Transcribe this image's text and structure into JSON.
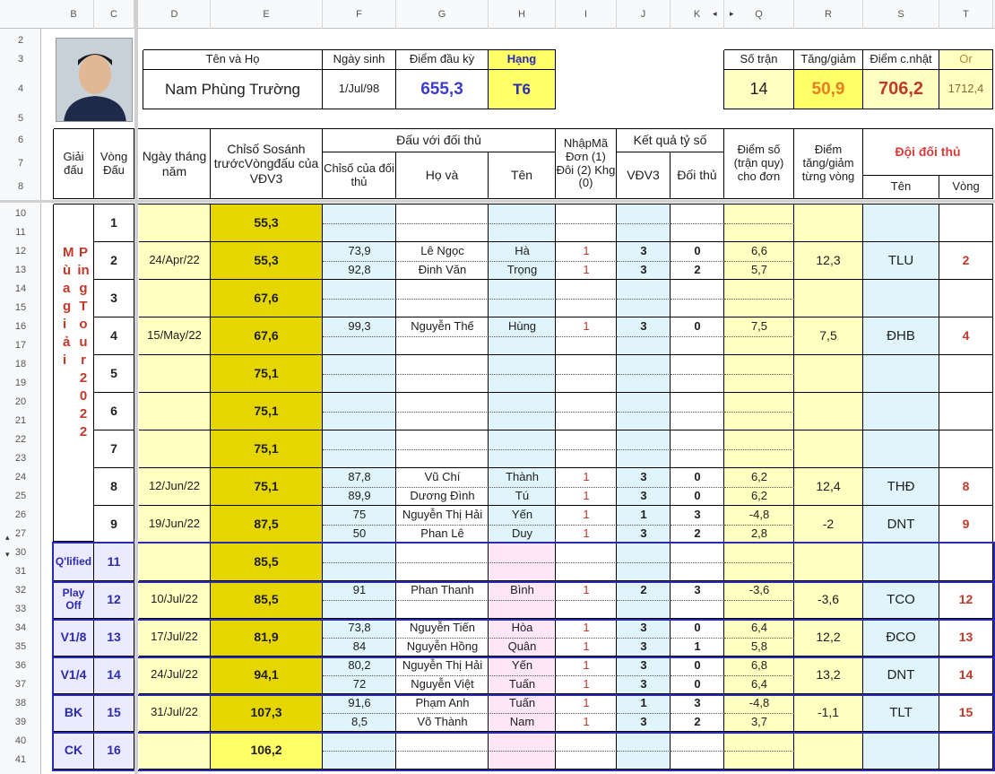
{
  "columns": [
    "B",
    "C",
    "D",
    "E",
    "F",
    "G",
    "H",
    "I",
    "J",
    "K",
    "Q",
    "R",
    "S",
    "T"
  ],
  "rows": [
    "2",
    "3",
    "4",
    "5",
    "6",
    "7",
    "8",
    "10",
    "11",
    "12",
    "13",
    "14",
    "15",
    "16",
    "17",
    "18",
    "19",
    "20",
    "21",
    "22",
    "23",
    "24",
    "25",
    "26",
    "27",
    "30",
    "31",
    "32",
    "33",
    "34",
    "35",
    "36",
    "37",
    "38",
    "39",
    "40",
    "41"
  ],
  "colors": {
    "yellow": "#ffff66",
    "olive": "#e6d600",
    "lightyellow": "#ffffc0",
    "cyan": "#dff5fb",
    "pink": "#fde6f6",
    "lavender": "#eceaff",
    "blueBorder": "#2b2bb0"
  },
  "profile": {
    "photo_icon": "person-photo-icon",
    "name_header": "Tên    và    Họ",
    "dob_header": "Ngày sinh",
    "start_points_header": "Điểm đầu kỳ",
    "rank_header": "Hạng",
    "name": "Nam Phùng Trường",
    "dob": "1/Jul/98",
    "start_points": "655,3",
    "rank": "T6"
  },
  "summary": {
    "matches_header": "Số trận",
    "change_header": "Tăng/giảm",
    "current_header": "Điểm c.nhật",
    "or_header": "Or",
    "matches": "14",
    "change": "50,9",
    "current": "706,2",
    "or": "1712,4"
  },
  "headers": {
    "tournament": "Giải đấu",
    "round": "Vòng Đấu",
    "date": "Ngày tháng năm",
    "index_before": "Chỉsố Sosánh trướcVòngđấu của VĐV3",
    "opponent_group": "Đấu với đối thủ",
    "opp_index": "Chỉsố của đối thủ",
    "opp_ho": "Họ    và",
    "opp_ten": "Tên",
    "entry_code": "NhậpMã Đơn (1) Đôi (2) Khg (0)",
    "result_group": "Kết quả tỷ số",
    "vdv3": "VĐV3",
    "opp": "Đối thủ",
    "score": "Điểm số (trận quy) cho đơn",
    "delta": "Điểm tăng/giảm từng vòng",
    "opp_team_group": "Đội đối thủ",
    "team_name": "Tên",
    "team_round": "Vòng"
  },
  "tournament_label": "Mùa giải",
  "tournament_label2": "PingTour 2022",
  "stage_labels": {
    "qualified": "Q'lified",
    "playoff": "Play Off",
    "v18": "V1/8",
    "v14": "V1/4",
    "bk": "BK",
    "ck": "CK"
  },
  "rounds": [
    {
      "round": "1",
      "date": "",
      "index": "55,3",
      "matches": [],
      "delta": "",
      "team": "",
      "team_round": ""
    },
    {
      "round": "2",
      "date": "24/Apr/22",
      "index": "55,3",
      "matches": [
        {
          "opp_index": "73,9",
          "ho": "Lê Ngọc",
          "ten": "Hà",
          "code": "1",
          "a": "3",
          "b": "0",
          "score": "6,6"
        },
        {
          "opp_index": "92,8",
          "ho": "Đinh Văn",
          "ten": "Trọng",
          "code": "1",
          "a": "3",
          "b": "2",
          "score": "5,7"
        }
      ],
      "delta": "12,3",
      "team": "TLU",
      "team_round": "2"
    },
    {
      "round": "3",
      "date": "",
      "index": "67,6",
      "matches": [],
      "delta": "",
      "team": "",
      "team_round": ""
    },
    {
      "round": "4",
      "date": "15/May/22",
      "index": "67,6",
      "matches": [
        {
          "opp_index": "99,3",
          "ho": "Nguyễn Thế",
          "ten": "Hùng",
          "code": "1",
          "a": "3",
          "b": "0",
          "score": "7,5"
        }
      ],
      "delta": "7,5",
      "team": "ĐHB",
      "team_round": "4"
    },
    {
      "round": "5",
      "date": "",
      "index": "75,1",
      "matches": [],
      "delta": "",
      "team": "",
      "team_round": ""
    },
    {
      "round": "6",
      "date": "",
      "index": "75,1",
      "matches": [],
      "delta": "",
      "team": "",
      "team_round": ""
    },
    {
      "round": "7",
      "date": "",
      "index": "75,1",
      "matches": [],
      "delta": "",
      "team": "",
      "team_round": ""
    },
    {
      "round": "8",
      "date": "12/Jun/22",
      "index": "75,1",
      "matches": [
        {
          "opp_index": "87,8",
          "ho": "Vũ Chí",
          "ten": "Thành",
          "code": "1",
          "a": "3",
          "b": "0",
          "score": "6,2"
        },
        {
          "opp_index": "89,9",
          "ho": "Dương Đình",
          "ten": "Tú",
          "code": "1",
          "a": "3",
          "b": "0",
          "score": "6,2"
        }
      ],
      "delta": "12,4",
      "team": "THĐ",
      "team_round": "8"
    },
    {
      "round": "9",
      "date": "19/Jun/22",
      "index": "87,5",
      "matches": [
        {
          "opp_index": "75",
          "ho": "Nguyễn Thị Hải",
          "ten": "Yến",
          "code": "1",
          "a": "1",
          "b": "3",
          "score": "-4,8"
        },
        {
          "opp_index": "50",
          "ho": "Phan Lê",
          "ten": "Duy",
          "code": "1",
          "a": "3",
          "b": "2",
          "score": "2,8"
        }
      ],
      "delta": "-2",
      "team": "DNT",
      "team_round": "9"
    },
    {
      "round": "11",
      "date": "",
      "index": "85,5",
      "matches": [],
      "delta": "",
      "team": "",
      "team_round": ""
    },
    {
      "round": "12",
      "date": "10/Jul/22",
      "index": "85,5",
      "matches": [
        {
          "opp_index": "91",
          "ho": "Phan Thanh",
          "ten": "Bình",
          "code": "1",
          "a": "2",
          "b": "3",
          "score": "-3,6"
        }
      ],
      "delta": "-3,6",
      "team": "TCO",
      "team_round": "12"
    },
    {
      "round": "13",
      "date": "17/Jul/22",
      "index": "81,9",
      "matches": [
        {
          "opp_index": "73,8",
          "ho": "Nguyễn Tiến",
          "ten": "Hòa",
          "code": "1",
          "a": "3",
          "b": "0",
          "score": "6,4"
        },
        {
          "opp_index": "84",
          "ho": "Nguyễn Hồng",
          "ten": "Quân",
          "code": "1",
          "a": "3",
          "b": "1",
          "score": "5,8"
        }
      ],
      "delta": "12,2",
      "team": "ĐCO",
      "team_round": "13"
    },
    {
      "round": "14",
      "date": "24/Jul/22",
      "index": "94,1",
      "matches": [
        {
          "opp_index": "80,2",
          "ho": "Nguyễn Thị Hải",
          "ten": "Yến",
          "code": "1",
          "a": "3",
          "b": "0",
          "score": "6,8"
        },
        {
          "opp_index": "72",
          "ho": "Nguyễn Việt",
          "ten": "Tuấn",
          "code": "1",
          "a": "3",
          "b": "0",
          "score": "6,4"
        }
      ],
      "delta": "13,2",
      "team": "DNT",
      "team_round": "14"
    },
    {
      "round": "15",
      "date": "31/Jul/22",
      "index": "107,3",
      "matches": [
        {
          "opp_index": "91,6",
          "ho": "Phạm Anh",
          "ten": "Tuấn",
          "code": "1",
          "a": "1",
          "b": "3",
          "score": "-4,8"
        },
        {
          "opp_index": "8,5",
          "ho": "Võ Thành",
          "ten": "Nam",
          "code": "1",
          "a": "3",
          "b": "2",
          "score": "3,7"
        }
      ],
      "delta": "-1,1",
      "team": "TLT",
      "team_round": "15"
    },
    {
      "round": "16",
      "date": "",
      "index": "106,2",
      "matches": [],
      "delta": "",
      "team": "",
      "team_round": ""
    }
  ]
}
